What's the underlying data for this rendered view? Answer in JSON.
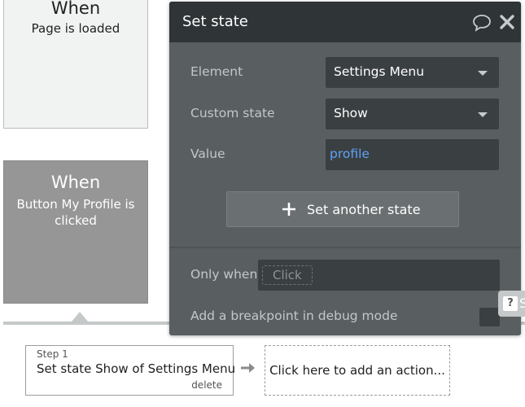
{
  "events": [
    {
      "when": "When",
      "description": "Page is loaded"
    },
    {
      "when": "When",
      "description": "Button My Profile is clicked"
    }
  ],
  "panel": {
    "title": "Set state",
    "fields": {
      "element_label": "Element",
      "element_value": "Settings Menu",
      "custom_state_label": "Custom state",
      "custom_state_value": "Show",
      "value_label": "Value",
      "value_value": "profile"
    },
    "set_another_label": "Set another state",
    "only_when_label": "Only when",
    "only_when_placeholder": "Click",
    "breakpoint_label": "Add a breakpoint in debug mode"
  },
  "workflow": {
    "step_number": "Step 1",
    "step_title": "Set state Show of Settings Menu",
    "delete_label": "delete",
    "add_action_label": "Click here to add an action..."
  },
  "help_tab": {
    "icon_char": "?",
    "label": "S"
  },
  "colors": {
    "panel_bg": "#595e60",
    "panel_header": "#2f3436",
    "field_bg": "#3a3f41",
    "link_blue": "#5fa2f5",
    "event_selected": "#969696"
  }
}
